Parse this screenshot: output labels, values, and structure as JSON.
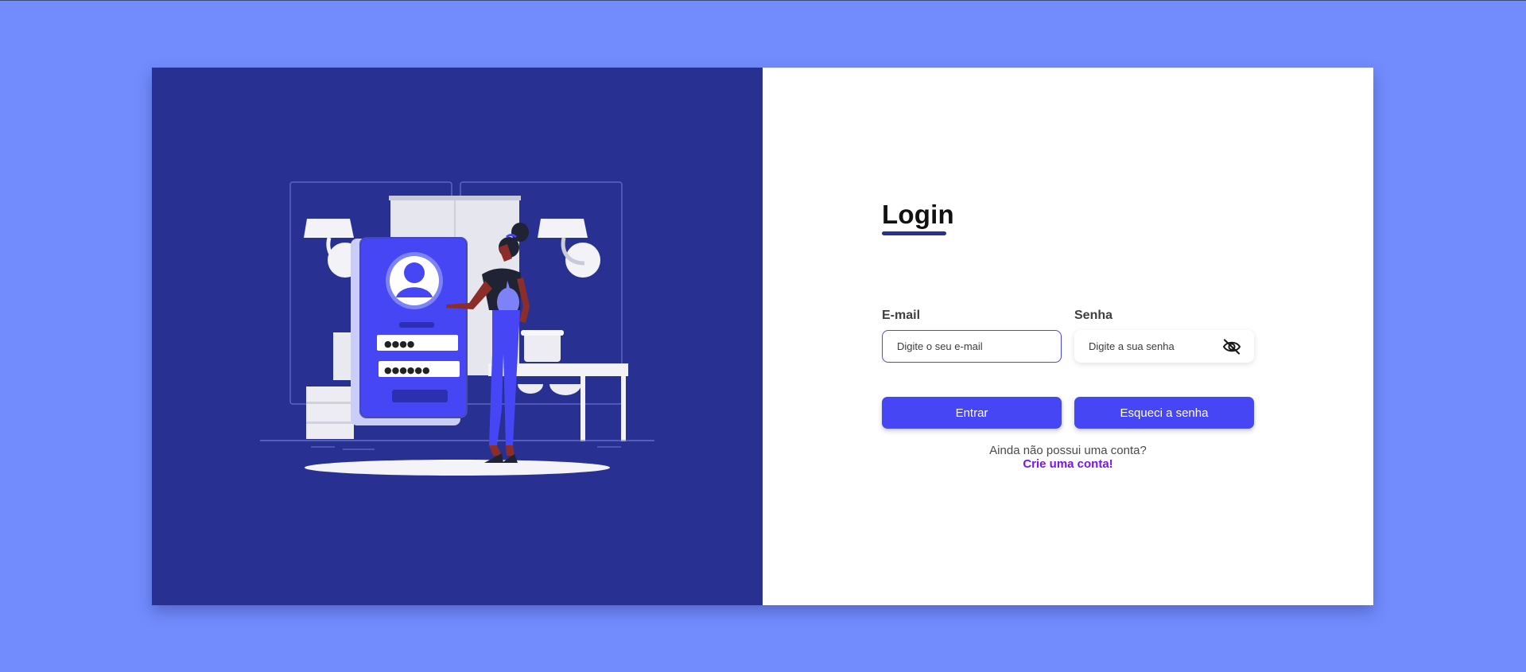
{
  "login": {
    "title": "Login",
    "email_label": "E-mail",
    "email_placeholder": "Digite o seu e-mail",
    "email_value": "",
    "password_label": "Senha",
    "password_placeholder": "Digite a sua senha",
    "password_value": "",
    "password_toggle_icon": "eye-slash-icon",
    "login_button": "Entrar",
    "forgot_button": "Esqueci a senha",
    "signup_prompt": "Ainda não possui uma conta?",
    "signup_link": "Crie uma conta!"
  },
  "illustration": {
    "password_mask_1": "●●●●",
    "password_mask_2": "●●●●●●"
  },
  "colors": {
    "page_background": "#728cfd",
    "left_panel": "#283191",
    "accent": "#4646f5",
    "link": "#7b12f0"
  }
}
